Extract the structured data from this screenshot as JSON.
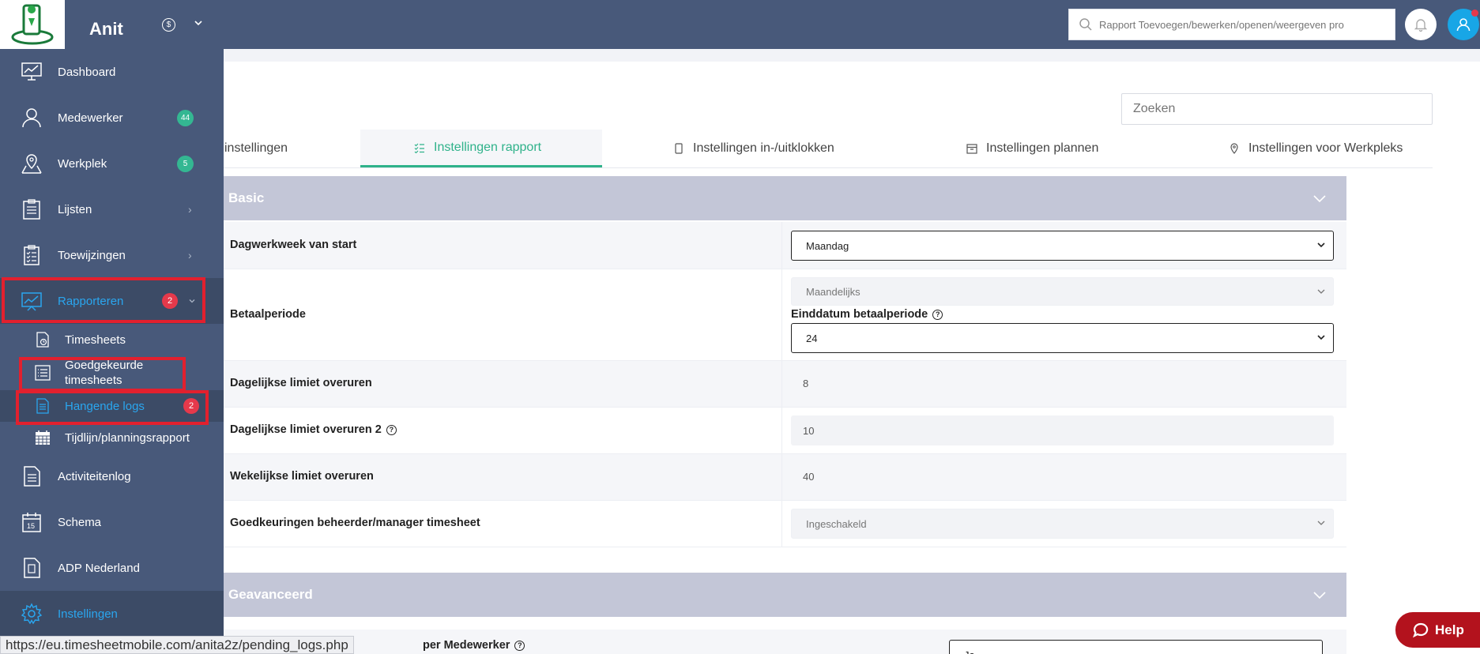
{
  "app": {
    "name": "Anit"
  },
  "topbar": {
    "search_placeholder": "Rapport Toevoegen/bewerken/openen/weergeven pro",
    "currency_symbol": "$"
  },
  "sidebar": {
    "items": [
      {
        "label": "Dashboard",
        "icon": "dashboard-chart-icon"
      },
      {
        "label": "Medewerker",
        "icon": "users-icon",
        "badge": "44"
      },
      {
        "label": "Werkplek",
        "icon": "map-pin-icon",
        "badge": "5"
      },
      {
        "label": "Lijsten",
        "icon": "clipboard-list-icon",
        "chevron": "›"
      },
      {
        "label": "Toewijzingen",
        "icon": "clipboard-check-icon",
        "chevron": "›"
      },
      {
        "label": "Rapporteren",
        "icon": "report-chart-icon",
        "badge": "2",
        "chevron": "⌄"
      },
      {
        "label": "Activiteitenlog",
        "icon": "document-icon"
      },
      {
        "label": "Schema",
        "icon": "calendar-icon"
      },
      {
        "label": "ADP Nederland",
        "icon": "adp-icon"
      },
      {
        "label": "Instellingen",
        "icon": "gear-icon"
      }
    ],
    "subitems": [
      {
        "label": "Timesheets",
        "icon": "timesheet-icon"
      },
      {
        "label": "Goedgekeurde timesheets",
        "icon": "list-icon"
      },
      {
        "label": "Hangende logs",
        "icon": "pending-log-icon",
        "badge": "2"
      },
      {
        "label": "Tijdlijn/planningsrapport",
        "icon": "calendar-grid-icon"
      }
    ]
  },
  "main": {
    "search_placeholder": "Zoeken",
    "tabs": [
      {
        "label": "instellingen",
        "icon": ""
      },
      {
        "label": "Instellingen rapport",
        "icon": "checklist-icon"
      },
      {
        "label": "Instellingen in-/uitklokken",
        "icon": "phone-icon"
      },
      {
        "label": "Instellingen plannen",
        "icon": "calendar-small-icon"
      },
      {
        "label": "Instellingen voor Werkpleks",
        "icon": "pin-small-icon"
      }
    ],
    "basic": {
      "title": "Basic",
      "rows": [
        {
          "label": "Dagwerkweek van start",
          "value": "Maandag"
        },
        {
          "label": "Betaalperiode",
          "value": "Maandelijks",
          "sub_label": "Einddatum betaalperiode",
          "sub_value": "24"
        },
        {
          "label": "Dagelijkse limiet overuren",
          "value": "8"
        },
        {
          "label": "Dagelijkse limiet overuren 2",
          "value": "10"
        },
        {
          "label": "Wekelijkse limiet overuren",
          "value": "40"
        },
        {
          "label": "Goedkeuringen beheerder/manager timesheet",
          "value": "Ingeschakeld"
        }
      ]
    },
    "advanced": {
      "title": "Geavanceerd",
      "row_label_partial": "per Medewerker",
      "row_value_partial": "Ja"
    }
  },
  "statusbar": {
    "url": "https://eu.timesheetmobile.com/anita2z/pending_logs.php"
  },
  "help": {
    "label": "Help"
  },
  "colors": {
    "sidebar": "#48597a",
    "accent_green": "#2fb28a",
    "accent_blue": "#2aa6ef",
    "badge_red": "#e5394b",
    "badge_green": "#34b792",
    "highlight_box": "#e2202e"
  }
}
